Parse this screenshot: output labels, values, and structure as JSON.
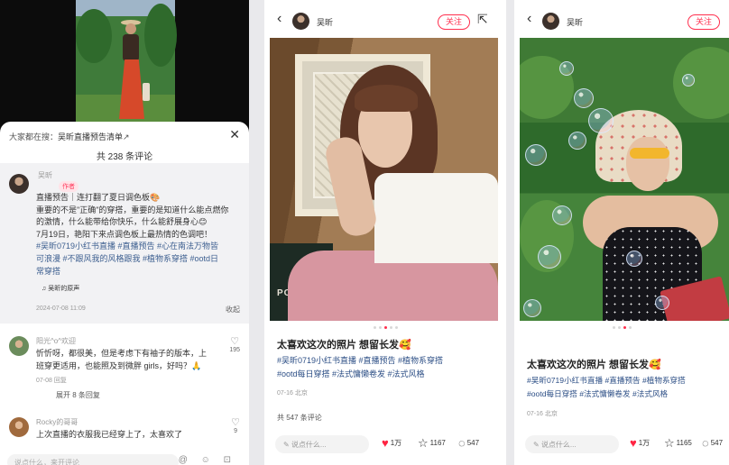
{
  "panel1": {
    "search_prefix": "大家都在搜：",
    "search_term": "吴昕直播预告清单",
    "search_arrow": "↗",
    "comment_count": "共 238 条评论",
    "post": {
      "author": "吴昕",
      "author_tag": "作者",
      "body_lines": [
        "直播预告｜连打翻了夏日调色板🎨",
        "重要的不是\"正确\"的穿搭，重要的是知道什么能点燃你",
        "的激情，什么能带给你快乐，什么能舒展身心😊",
        "7月19日，艳阳下来点调色板上最热情的色调吧！"
      ],
      "tags_lines": [
        "#吴昕0719小红书直播 #直播预告 #心在南法万物皆",
        "可浪漫 #不跟风我的风格跟我 #植物系穿搭 #ootd日",
        "常穿搭"
      ],
      "music": "吴昕的原声",
      "date": "2024-07-08 11:09",
      "reply": "收起"
    },
    "comments": [
      {
        "name": "阳光^o^欢迎",
        "text_lines": [
          "忻忻呀，都很美，但是考虑下有袖子的版本，上",
          "班穿更适用，也能照及到微胖 girls，好吗？🙏"
        ],
        "meta": "07-08 回复",
        "likes": "195",
        "expand": "展开 8 条回复"
      },
      {
        "name": "Rocky的哥哥",
        "text_lines": [
          "上次直播的衣服我已经穿上了，太喜欢了"
        ],
        "likes": "9"
      }
    ],
    "input_placeholder": "说点什么，来开评论",
    "input_icons": "@ ☺ ⊡"
  },
  "note_a": {
    "author": "吴昕",
    "follow": "关注",
    "photo_text": "PORTSAC",
    "title": "太喜欢这次的照片 想留长发🥰",
    "tags_lines": [
      "#吴昕0719小红书直播 #直播预告 #植物系穿搭",
      "#ootd每日穿搭 #法式慵懒卷发 #法式风格"
    ],
    "date": "07-16 北京",
    "comments_label": "共 547 条评论",
    "input_placeholder": "说点什么...",
    "likes": "1万",
    "stars": "1167",
    "comments": "547"
  },
  "note_b": {
    "author": "吴昕",
    "follow": "关注",
    "title": "太喜欢这次的照片 想留长发🥰",
    "tags_lines": [
      "#吴昕0719小红书直播 #直播预告 #植物系穿搭",
      "#ootd每日穿搭 #法式慵懒卷发 #法式风格"
    ],
    "date": "07-16 北京",
    "input_placeholder": "说点什么...",
    "likes": "1万",
    "stars": "1165",
    "comments": "547"
  },
  "icons": {
    "back": "chevron-left-icon",
    "share": "share-icon",
    "close": "close-icon",
    "heart": "heart-icon",
    "star": "star-icon",
    "comment": "comment-icon",
    "pen": "pen-icon",
    "music": "music-icon"
  },
  "colors": {
    "accent": "#ff2442",
    "tag_link": "#2d4f86",
    "author_tag": "#ff3b5c"
  }
}
